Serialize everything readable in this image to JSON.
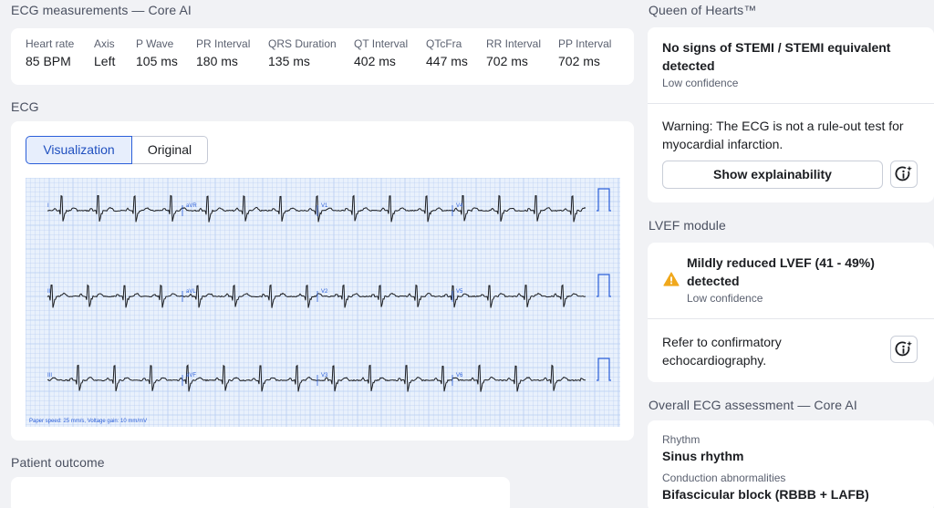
{
  "measurements": {
    "section_title": "ECG measurements — Core AI",
    "items": [
      {
        "label": "Heart rate",
        "value": "85 BPM"
      },
      {
        "label": "Axis",
        "value": "Left"
      },
      {
        "label": "P Wave",
        "value": "105 ms"
      },
      {
        "label": "PR Interval",
        "value": "180 ms"
      },
      {
        "label": "QRS Duration",
        "value": "135 ms"
      },
      {
        "label": "QT Interval",
        "value": "402 ms"
      },
      {
        "label": "QTcFra",
        "value": "447 ms"
      },
      {
        "label": "RR Interval",
        "value": "702 ms"
      },
      {
        "label": "PP Interval",
        "value": "702 ms"
      }
    ]
  },
  "ecg": {
    "section_title": "ECG",
    "tabs": [
      {
        "label": "Visualization",
        "active": true
      },
      {
        "label": "Original",
        "active": false
      }
    ],
    "leads": [
      "I",
      "aVR",
      "V1",
      "V4",
      "II",
      "aVL",
      "V2",
      "V5",
      "III",
      "aVF",
      "V3",
      "V6"
    ],
    "footer": "Paper speed: 25 mm/s, Voltage gain: 10 mm/mV"
  },
  "patient_outcome": {
    "section_title": "Patient outcome"
  },
  "queen": {
    "section_title": "Queen of Hearts™",
    "result": "No signs of STEMI / STEMI equivalent detected",
    "confidence": "Low confidence",
    "warning": "Warning: The ECG is not a rule-out test for myocardial infarction.",
    "explain_button": "Show explainability"
  },
  "lvef": {
    "section_title": "LVEF module",
    "result": "Mildly reduced LVEF (41 - 49%) detected",
    "confidence": "Low confidence",
    "refer": "Refer to confirmatory echocardiography."
  },
  "overall": {
    "section_title": "Overall ECG assessment — Core AI",
    "rhythm_label": "Rhythm",
    "rhythm_value": "Sinus rhythm",
    "conduction_label": "Conduction abnormalities",
    "conduction_value": "Bifascicular block (RBBB + LAFB)"
  },
  "colors": {
    "accent": "#2b5fd9",
    "warning": "#f0a81c",
    "grid": "#b7cdf2"
  }
}
